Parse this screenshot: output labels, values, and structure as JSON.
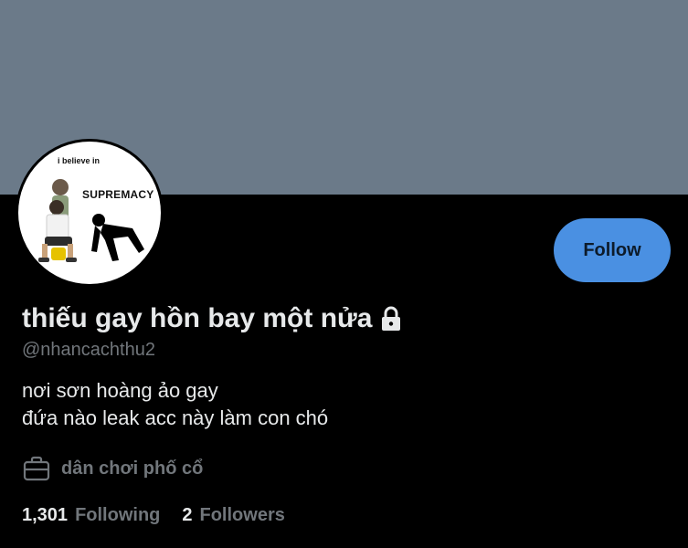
{
  "profile": {
    "display_name": "thiếu gay hồn bay một nửa",
    "handle": "@nhancachthu2",
    "bio_lines": [
      "nơi sơn hoàng ảo gay",
      "đứa nào leak acc này làm con chó"
    ],
    "profession": "dân chơi phố cổ",
    "locked_icon": "lock-icon",
    "avatar": {
      "caption": "i believe in",
      "word": "SUPREMACY"
    }
  },
  "actions": {
    "follow_label": "Follow"
  },
  "stats": {
    "following_count": "1,301",
    "following_label": "Following",
    "followers_count": "2",
    "followers_label": "Followers"
  },
  "colors": {
    "banner": "#6b7a89",
    "accent": "#4a90e2",
    "background": "#000000",
    "muted_text": "#71767b"
  }
}
